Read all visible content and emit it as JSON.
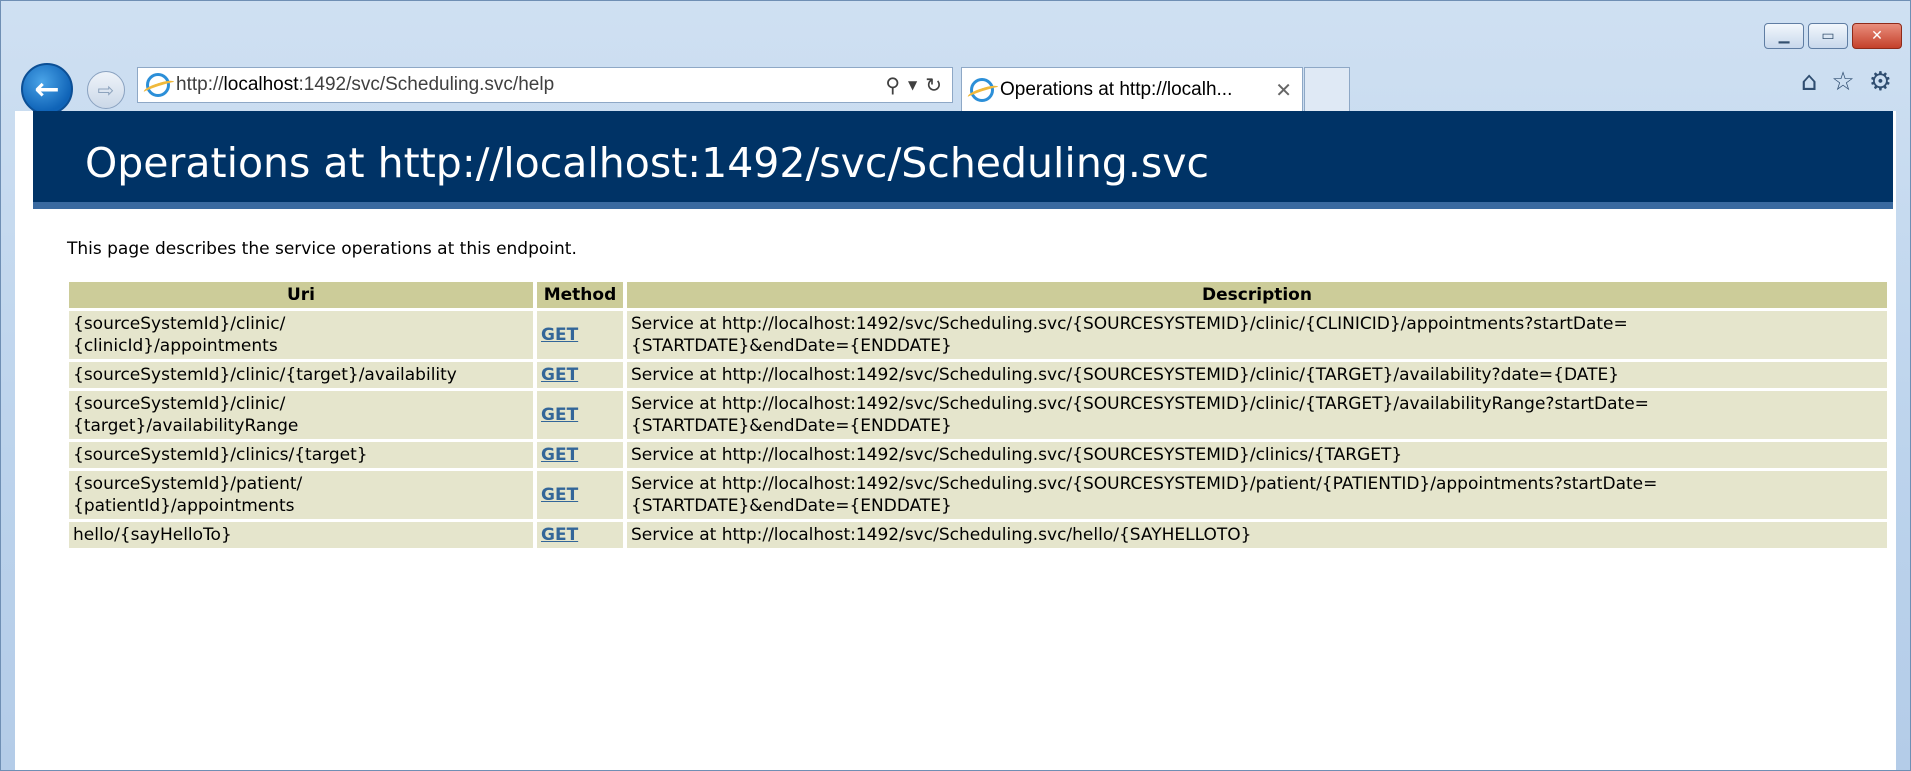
{
  "browser": {
    "address": {
      "prefix": "http://",
      "host": "localhost",
      "rest": ":1492/svc/Scheduling.svc/help"
    },
    "tab": {
      "title": "Operations at http://localh...",
      "close_glyph": "✕"
    },
    "icons": [
      "back-icon",
      "forward-icon",
      "ie-icon",
      "search-icon",
      "refresh-icon",
      "home-icon",
      "favorites-star-icon",
      "settings-gear-icon"
    ]
  },
  "page": {
    "title": "Operations at http://localhost:1492/svc/Scheduling.svc",
    "intro": "This page describes the service operations at this endpoint.",
    "table": {
      "headers": [
        "Uri",
        "Method",
        "Description"
      ],
      "rows": [
        {
          "uri_lines": [
            "{sourceSystemId}/clinic/",
            "{clinicId}/appointments"
          ],
          "method": "GET",
          "desc_lines": [
            "Service at http://localhost:1492/svc/Scheduling.svc/{SOURCESYSTEMID}/clinic/{CLINICID}/appointments?startDate=",
            "{STARTDATE}&endDate={ENDDATE}"
          ]
        },
        {
          "uri_lines": [
            "{sourceSystemId}/clinic/{target}/availability"
          ],
          "method": "GET",
          "desc_lines": [
            "Service at http://localhost:1492/svc/Scheduling.svc/{SOURCESYSTEMID}/clinic/{TARGET}/availability?date={DATE}"
          ]
        },
        {
          "uri_lines": [
            "{sourceSystemId}/clinic/",
            "{target}/availabilityRange"
          ],
          "method": "GET",
          "desc_lines": [
            "Service at http://localhost:1492/svc/Scheduling.svc/{SOURCESYSTEMID}/clinic/{TARGET}/availabilityRange?startDate=",
            "{STARTDATE}&endDate={ENDDATE}"
          ]
        },
        {
          "uri_lines": [
            "{sourceSystemId}/clinics/{target}"
          ],
          "method": "GET",
          "desc_lines": [
            "Service at http://localhost:1492/svc/Scheduling.svc/{SOURCESYSTEMID}/clinics/{TARGET}"
          ]
        },
        {
          "uri_lines": [
            "{sourceSystemId}/patient/",
            "{patientId}/appointments"
          ],
          "method": "GET",
          "desc_lines": [
            "Service at http://localhost:1492/svc/Scheduling.svc/{SOURCESYSTEMID}/patient/{PATIENTID}/appointments?startDate=",
            "{STARTDATE}&endDate={ENDDATE}"
          ]
        },
        {
          "uri_lines": [
            "hello/{sayHelloTo}"
          ],
          "method": "GET",
          "desc_lines": [
            "Service at http://localhost:1492/svc/Scheduling.svc/hello/{SAYHELLOTO}"
          ]
        }
      ]
    }
  },
  "colors": {
    "banner": "#003366",
    "header_cell": "#cccc99",
    "data_cell": "#e5e5cc",
    "link": "#336699"
  }
}
